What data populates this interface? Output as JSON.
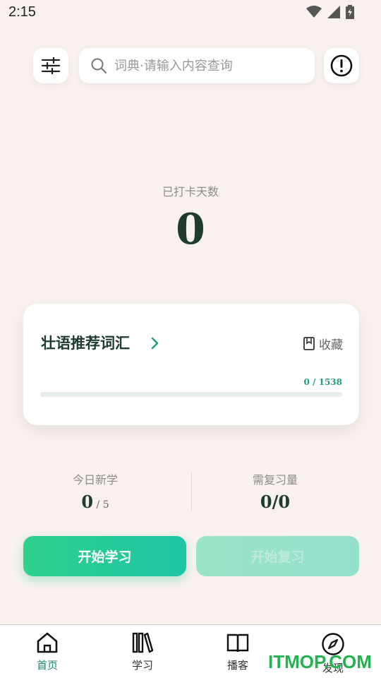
{
  "status_bar": {
    "time": "2:15"
  },
  "search": {
    "placeholder": "词典·请输入内容查询"
  },
  "checkin": {
    "label": "已打卡天数",
    "days": "0"
  },
  "wordlist": {
    "title": "壮语推荐词汇",
    "favorite_label": "收藏",
    "progress_text": "0 / 1538",
    "progress_fraction": 0
  },
  "stats": {
    "today_new": {
      "label": "今日新学",
      "value": "0",
      "goal": " / 5"
    },
    "review": {
      "label": "需复习量",
      "value": "0/0"
    }
  },
  "buttons": {
    "start_learning": "开始学习",
    "start_review": "开始复习"
  },
  "nav": [
    {
      "label": "首页",
      "icon": "home-icon",
      "active": true
    },
    {
      "label": "学习",
      "icon": "books-icon",
      "active": false
    },
    {
      "label": "播客",
      "icon": "open-book-icon",
      "active": false
    },
    {
      "label": "发现",
      "icon": "compass-icon",
      "active": false
    }
  ],
  "watermark": "ITMOP.COM",
  "colors": {
    "accent": "#25c297",
    "text_dark": "#1d3b2f",
    "background": "#f8f1ee"
  }
}
